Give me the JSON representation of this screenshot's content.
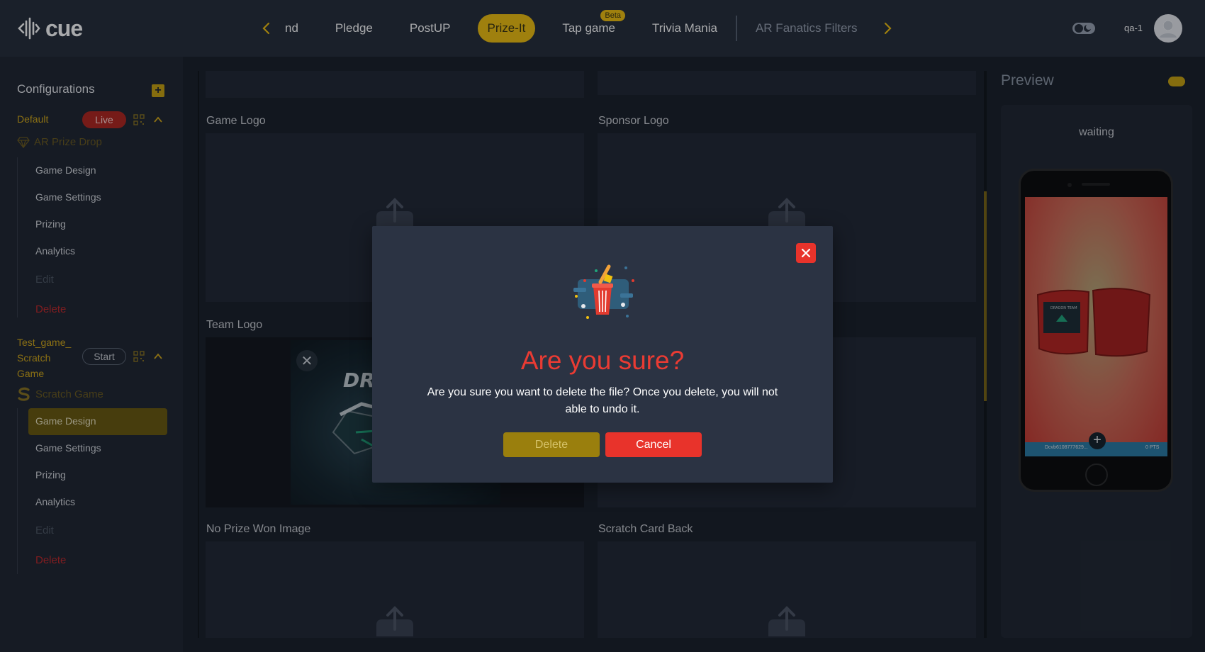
{
  "app": {
    "logo_text": "cue",
    "user_name": "qa-1"
  },
  "nav": {
    "tabs": [
      {
        "label": "nd"
      },
      {
        "label": "Pledge"
      },
      {
        "label": "PostUP"
      },
      {
        "label": "Prize-It"
      },
      {
        "label": "Tap game",
        "badge": "Beta"
      },
      {
        "label": "Trivia Mania"
      },
      {
        "label": "AR Fanatics Filters"
      }
    ],
    "active_tab": "Prize-It",
    "accent_color": "#f2c10f"
  },
  "sidebar": {
    "title": "Configurations",
    "configs": [
      {
        "name": "Default",
        "status": "Live",
        "game_type": "AR Prize Drop",
        "items": [
          "Game Design",
          "Game Settings",
          "Prizing",
          "Analytics",
          "Edit",
          "Delete"
        ]
      },
      {
        "name_lines": [
          "Test_game_",
          "Scratch",
          "Game"
        ],
        "status": "Start",
        "game_type": "Scratch Game",
        "items": [
          "Game Design",
          "Game Settings",
          "Prizing",
          "Analytics",
          "Edit",
          "Delete"
        ],
        "active_item": "Game Design"
      }
    ]
  },
  "main": {
    "panels": [
      {
        "label": "Game Logo"
      },
      {
        "label": "Sponsor Logo"
      },
      {
        "label": "Team Logo"
      },
      {
        "label": "No Prize Won Image"
      },
      {
        "label": "Scratch Card Back"
      }
    ]
  },
  "preview": {
    "title": "Preview",
    "status": "waiting",
    "phone_bar_left": "Dcvb6108777629...",
    "phone_bar_right": "0 PTS"
  },
  "modal": {
    "title": "Are you sure?",
    "message": "Are you sure you want to delete the file? Once you delete, you will not able to undo it.",
    "delete_label": "Delete",
    "cancel_label": "Cancel",
    "title_color": "#ea3b33"
  }
}
